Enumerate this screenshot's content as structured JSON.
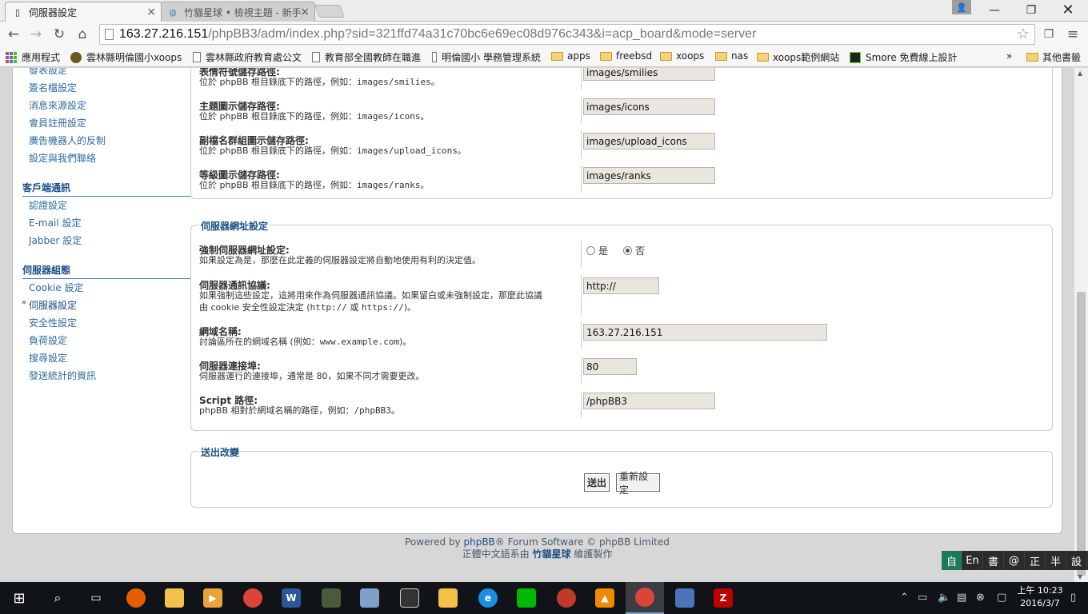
{
  "browser": {
    "tabs": [
      {
        "title": "伺服器設定",
        "icon": "page-icon"
      },
      {
        "title": "竹貓星球 • 檢視主題 - 新手",
        "icon": "globe-icon"
      }
    ],
    "url": {
      "host": "163.27.216.151",
      "path": "/phpBB3/adm/index.php?sid=321ffd74a31c70bc6e69ec08d976c343&i=acp_board&mode=server"
    },
    "bookmarks": [
      {
        "label": "應用程式",
        "icon": "apps-grid-icon"
      },
      {
        "label": "雲林縣明倫國小xoops",
        "icon": "school-icon"
      },
      {
        "label": "雲林縣政府教育處公文",
        "icon": "page-icon"
      },
      {
        "label": "教育部全國教師在職進",
        "icon": "page-icon"
      },
      {
        "label": "明倫國小 學務管理系統",
        "icon": "page-icon"
      },
      {
        "label": "apps",
        "icon": "folder-icon"
      },
      {
        "label": "freebsd",
        "icon": "folder-icon"
      },
      {
        "label": "xoops",
        "icon": "folder-icon"
      },
      {
        "label": "nas",
        "icon": "folder-icon"
      },
      {
        "label": "xoops範例網站",
        "icon": "folder-icon"
      },
      {
        "label": "Smore 免費線上設計",
        "icon": "smore-icon"
      }
    ],
    "overflow": "»",
    "other_bookmarks": "其他書籤"
  },
  "menu": {
    "items_top": [
      "發表設定",
      "簽名檔設定",
      "消息來源設定",
      "會員註冊設定",
      "廣告機器人的反制",
      "設定與我們聯絡"
    ],
    "section1": "客戶端通訊",
    "items1": [
      "認證設定",
      "E-mail 設定",
      "Jabber 設定"
    ],
    "section2": "伺服器組態",
    "items2": [
      "Cookie 設定",
      "伺服器設定",
      "安全性設定",
      "負荷設定",
      "搜尋設定",
      "發送統計的資訊"
    ]
  },
  "paths": [
    {
      "label": "表情符號儲存路徑:",
      "prefix": "位於 phpBB 根目錄底下的路徑，例如：",
      "example": "images/smilies",
      "suffix": "。",
      "value": "images/smilies"
    },
    {
      "label": "主題圖示儲存路徑:",
      "prefix": "位於 phpBB 根目錄底下的路徑，例如：",
      "example": "images/icons",
      "suffix": "。",
      "value": "images/icons"
    },
    {
      "label": "副檔名群組圖示儲存路徑:",
      "prefix": "位於 phpBB 根目錄底下的路徑，例如：",
      "example": "images/upload_icons",
      "suffix": "。",
      "value": "images/upload_icons"
    },
    {
      "label": "等級圖示儲存路徑:",
      "prefix": "位於 phpBB 根目錄底下的路徑，例如：",
      "example": "images/ranks",
      "suffix": "。",
      "value": "images/ranks"
    }
  ],
  "server_url": {
    "legend": "伺服器網址設定",
    "force": {
      "label": "強制伺服器網址設定:",
      "explain": "如果設定為是，那麼在此定義的伺服器設定將自動地使用有利的決定值。",
      "yes": "是",
      "no": "否",
      "selected": "否"
    },
    "protocol": {
      "label": "伺服器通訊協議:",
      "explain1": "如果強制這些設定，這將用來作為伺服器通訊協議。如果留白或未強制設定，那麼此協議",
      "explain2a": "由 cookie 安全性設定決定 (",
      "code1": "http://",
      "or": " 或 ",
      "code2": "https://",
      "explain2b": ")。",
      "value": "http://"
    },
    "domain": {
      "label": "網域名稱:",
      "explain_a": "討論區所在的網域名稱 (例如：",
      "code": "www.example.com",
      "explain_b": ")。",
      "value": "163.27.216.151"
    },
    "port": {
      "label": "伺服器連接埠:",
      "explain": "伺服器運行的連接埠，通常是 80，如果不同才需要更改。",
      "value": "80"
    },
    "script": {
      "label": "Script 路徑:",
      "explain_a": "phpBB 相對於網域名稱的路徑，例如：",
      "code": "/phpBB3",
      "explain_b": "。",
      "value": "/phpBB3"
    }
  },
  "submit": {
    "legend": "送出改變",
    "submit_label": "送出",
    "reset_label": "重新設定"
  },
  "footer": {
    "line1_a": "Powered by ",
    "line1_link": "phpBB",
    "line1_b": "® Forum Software © phpBB Limited",
    "line2_a": "正體中文語系由 ",
    "line2_link": "竹貓星球",
    "line2_b": " 維護製作"
  },
  "ime": {
    "items": [
      "自",
      "En",
      "書",
      "@",
      "正",
      "半",
      "設"
    ]
  },
  "taskbar": {
    "apps": [
      "start",
      "search",
      "task-view",
      "firefox",
      "file-explorer",
      "media-player",
      "chrome",
      "word",
      "game",
      "paint",
      "calculator",
      "folder",
      "ie",
      "line",
      "filezilla-alt",
      "vlc",
      "chrome-active",
      "network-tool",
      "filezilla"
    ]
  },
  "clock": {
    "time": "上午 10:23",
    "date": "2016/3/7"
  }
}
